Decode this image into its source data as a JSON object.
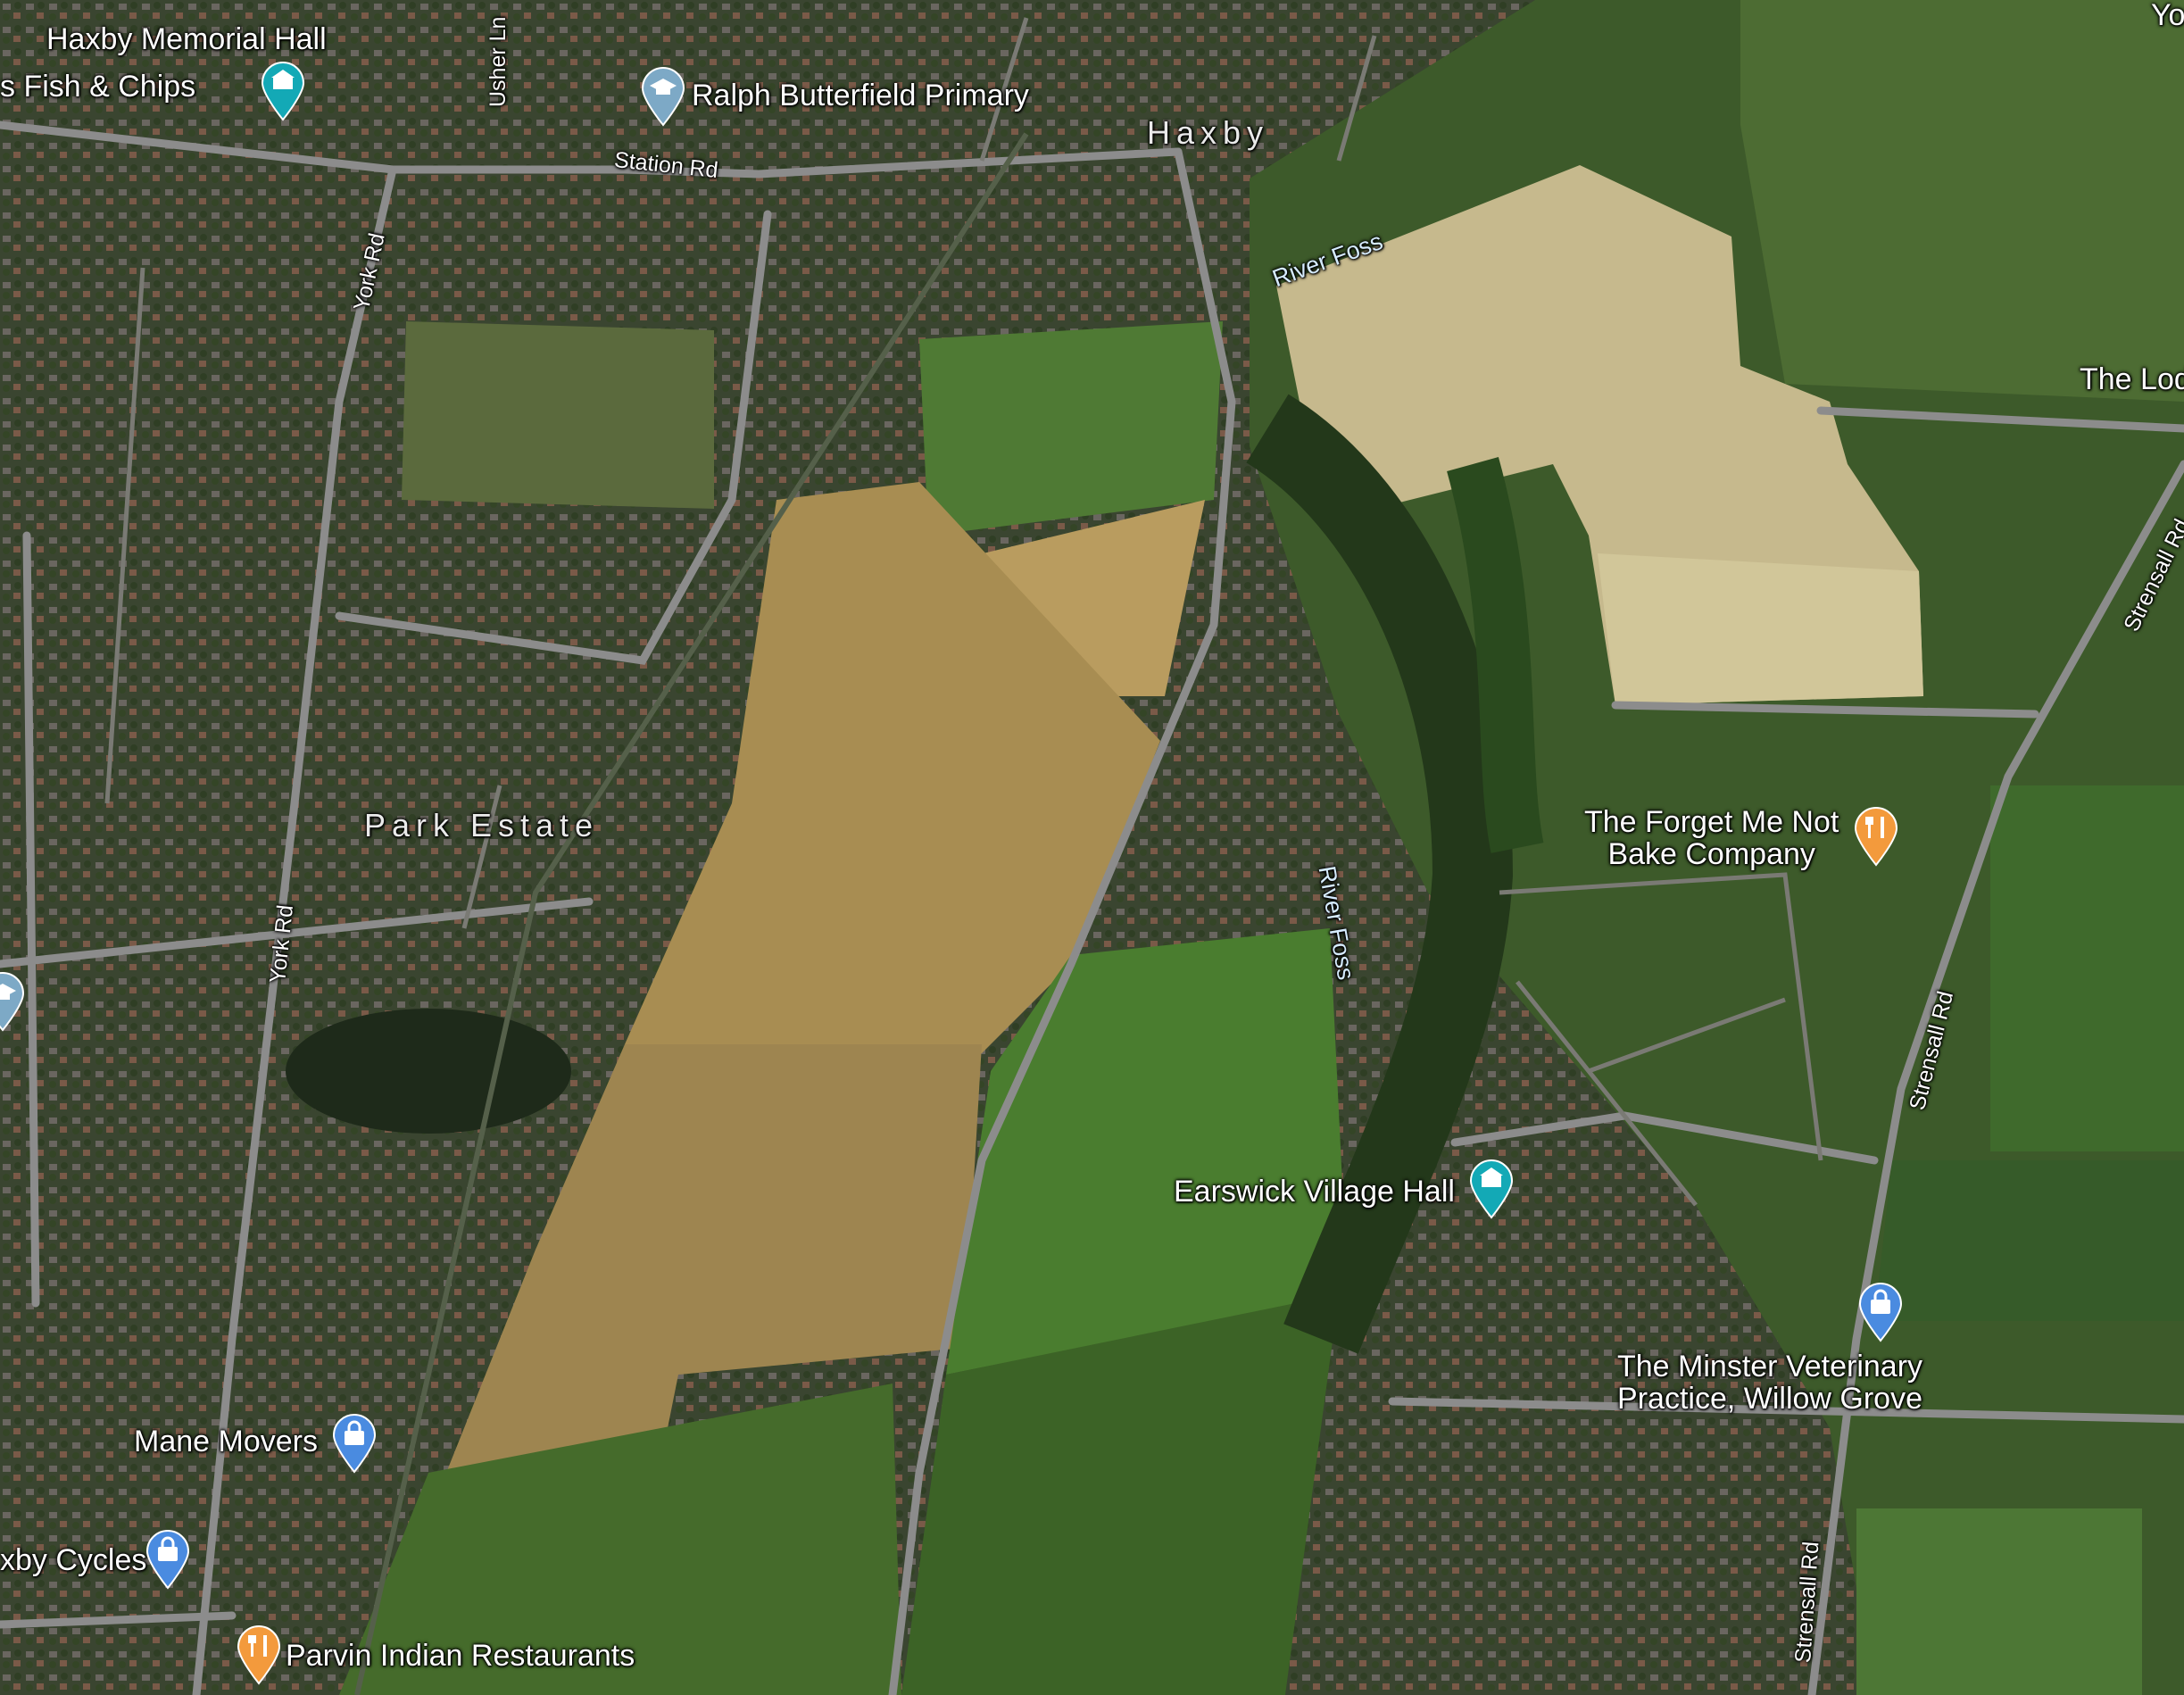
{
  "labels": {
    "haxby_memorial_hall": "Haxby Memorial Hall",
    "fish_chips": "s Fish & Chips",
    "ralph_butterfield": "Ralph Butterfield Primary",
    "usher_ln": "Usher Ln",
    "station_rd": "Station Rd",
    "york_rd_top": "York Rd",
    "york_rd_mid": "York Rd",
    "haxby": "Haxby",
    "river_foss_top": "River Foss",
    "river_foss_mid": "River Foss",
    "the_lodge": "The Lod",
    "yo_corner": "Yo",
    "strensall_rd_top": "Strensall Rd",
    "strensall_rd_mid": "Strensall Rd",
    "strensall_rd_bottom": "Strensall Rd",
    "park_estate": "Park Estate",
    "forget_me_not_1": "The Forget Me Not",
    "forget_me_not_2": "Bake Company",
    "earswick_village_hall": "Earswick Village Hall",
    "minster_vet_1": "The Minster Veterinary",
    "minster_vet_2": "Practice, Willow Grove",
    "mane_movers": "Mane Movers",
    "haxby_cycles": "xby Cycles",
    "parvin": "Parvin Indian Restaurants"
  },
  "icons": {
    "landmark": "civic-building-icon",
    "school": "school-cap-icon",
    "shopping": "shopping-bag-icon",
    "restaurant": "fork-knife-icon"
  },
  "colors": {
    "teal_pin": "#13a9b6",
    "blue_pin": "#4a8be0",
    "school_pin": "#7da9c6",
    "orange_pin": "#f39a3c"
  }
}
